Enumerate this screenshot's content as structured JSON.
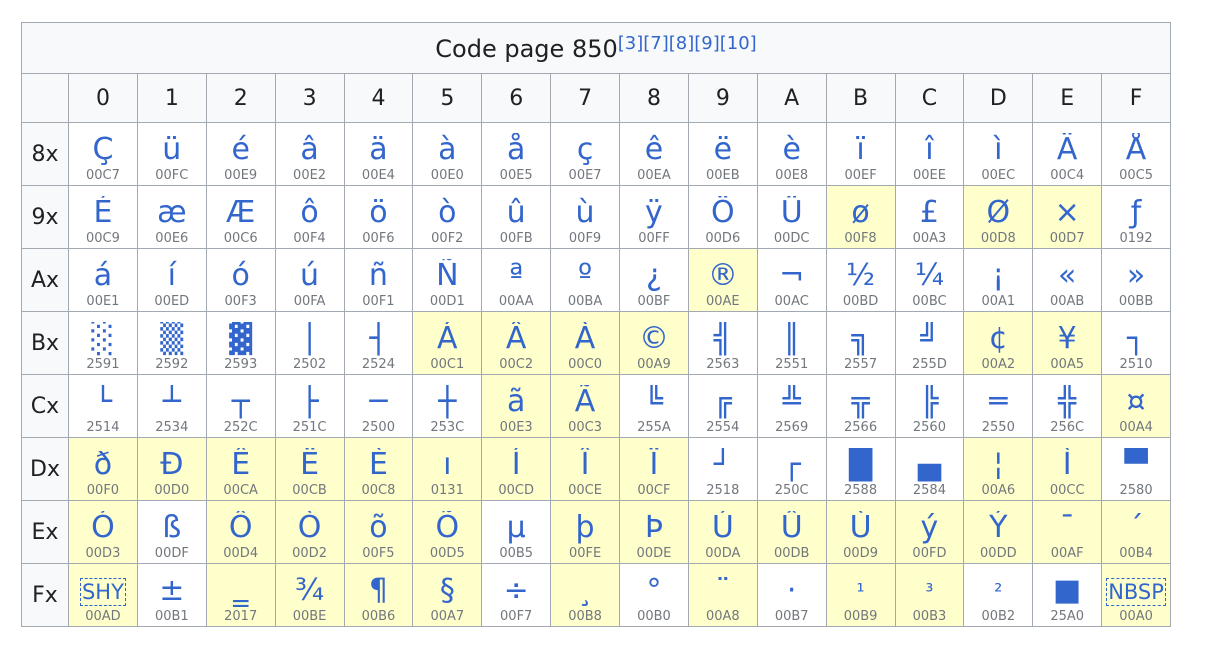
{
  "caption": {
    "title": "Code page 850",
    "refs": [
      "[3]",
      "[7]",
      "[8]",
      "[9]",
      "[10]"
    ]
  },
  "columns": [
    "0",
    "1",
    "2",
    "3",
    "4",
    "5",
    "6",
    "7",
    "8",
    "9",
    "A",
    "B",
    "C",
    "D",
    "E",
    "F"
  ],
  "rows": [
    {
      "label": "8x",
      "cells": [
        {
          "g": "Ç",
          "c": "00C7",
          "h": false
        },
        {
          "g": "ü",
          "c": "00FC",
          "h": false
        },
        {
          "g": "é",
          "c": "00E9",
          "h": false
        },
        {
          "g": "â",
          "c": "00E2",
          "h": false
        },
        {
          "g": "ä",
          "c": "00E4",
          "h": false
        },
        {
          "g": "à",
          "c": "00E0",
          "h": false
        },
        {
          "g": "å",
          "c": "00E5",
          "h": false
        },
        {
          "g": "ç",
          "c": "00E7",
          "h": false
        },
        {
          "g": "ê",
          "c": "00EA",
          "h": false
        },
        {
          "g": "ë",
          "c": "00EB",
          "h": false
        },
        {
          "g": "è",
          "c": "00E8",
          "h": false
        },
        {
          "g": "ï",
          "c": "00EF",
          "h": false
        },
        {
          "g": "î",
          "c": "00EE",
          "h": false
        },
        {
          "g": "ì",
          "c": "00EC",
          "h": false
        },
        {
          "g": "Ä",
          "c": "00C4",
          "h": false
        },
        {
          "g": "Å",
          "c": "00C5",
          "h": false
        }
      ]
    },
    {
      "label": "9x",
      "cells": [
        {
          "g": "É",
          "c": "00C9",
          "h": false
        },
        {
          "g": "æ",
          "c": "00E6",
          "h": false
        },
        {
          "g": "Æ",
          "c": "00C6",
          "h": false
        },
        {
          "g": "ô",
          "c": "00F4",
          "h": false
        },
        {
          "g": "ö",
          "c": "00F6",
          "h": false
        },
        {
          "g": "ò",
          "c": "00F2",
          "h": false
        },
        {
          "g": "û",
          "c": "00FB",
          "h": false
        },
        {
          "g": "ù",
          "c": "00F9",
          "h": false
        },
        {
          "g": "ÿ",
          "c": "00FF",
          "h": false
        },
        {
          "g": "Ö",
          "c": "00D6",
          "h": false
        },
        {
          "g": "Ü",
          "c": "00DC",
          "h": false
        },
        {
          "g": "ø",
          "c": "00F8",
          "h": true
        },
        {
          "g": "£",
          "c": "00A3",
          "h": false
        },
        {
          "g": "Ø",
          "c": "00D8",
          "h": true
        },
        {
          "g": "×",
          "c": "00D7",
          "h": true
        },
        {
          "g": "ƒ",
          "c": "0192",
          "h": false
        }
      ]
    },
    {
      "label": "Ax",
      "cells": [
        {
          "g": "á",
          "c": "00E1",
          "h": false
        },
        {
          "g": "í",
          "c": "00ED",
          "h": false
        },
        {
          "g": "ó",
          "c": "00F3",
          "h": false
        },
        {
          "g": "ú",
          "c": "00FA",
          "h": false
        },
        {
          "g": "ñ",
          "c": "00F1",
          "h": false
        },
        {
          "g": "Ñ",
          "c": "00D1",
          "h": false
        },
        {
          "g": "ª",
          "c": "00AA",
          "h": false
        },
        {
          "g": "º",
          "c": "00BA",
          "h": false
        },
        {
          "g": "¿",
          "c": "00BF",
          "h": false
        },
        {
          "g": "®",
          "c": "00AE",
          "h": true
        },
        {
          "g": "¬",
          "c": "00AC",
          "h": false
        },
        {
          "g": "½",
          "c": "00BD",
          "h": false
        },
        {
          "g": "¼",
          "c": "00BC",
          "h": false
        },
        {
          "g": "¡",
          "c": "00A1",
          "h": false
        },
        {
          "g": "«",
          "c": "00AB",
          "h": false
        },
        {
          "g": "»",
          "c": "00BB",
          "h": false
        }
      ]
    },
    {
      "label": "Bx",
      "cells": [
        {
          "g": "░",
          "c": "2591",
          "h": false
        },
        {
          "g": "▒",
          "c": "2592",
          "h": false
        },
        {
          "g": "▓",
          "c": "2593",
          "h": false
        },
        {
          "g": "│",
          "c": "2502",
          "h": false
        },
        {
          "g": "┤",
          "c": "2524",
          "h": false
        },
        {
          "g": "Á",
          "c": "00C1",
          "h": true
        },
        {
          "g": "Â",
          "c": "00C2",
          "h": true
        },
        {
          "g": "À",
          "c": "00C0",
          "h": true
        },
        {
          "g": "©",
          "c": "00A9",
          "h": true
        },
        {
          "g": "╣",
          "c": "2563",
          "h": false
        },
        {
          "g": "║",
          "c": "2551",
          "h": false
        },
        {
          "g": "╗",
          "c": "2557",
          "h": false
        },
        {
          "g": "╝",
          "c": "255D",
          "h": false
        },
        {
          "g": "¢",
          "c": "00A2",
          "h": true
        },
        {
          "g": "¥",
          "c": "00A5",
          "h": true
        },
        {
          "g": "┐",
          "c": "2510",
          "h": false
        }
      ]
    },
    {
      "label": "Cx",
      "cells": [
        {
          "g": "└",
          "c": "2514",
          "h": false
        },
        {
          "g": "┴",
          "c": "2534",
          "h": false
        },
        {
          "g": "┬",
          "c": "252C",
          "h": false
        },
        {
          "g": "├",
          "c": "251C",
          "h": false
        },
        {
          "g": "─",
          "c": "2500",
          "h": false
        },
        {
          "g": "┼",
          "c": "253C",
          "h": false
        },
        {
          "g": "ã",
          "c": "00E3",
          "h": true
        },
        {
          "g": "Ã",
          "c": "00C3",
          "h": true
        },
        {
          "g": "╚",
          "c": "255A",
          "h": false
        },
        {
          "g": "╔",
          "c": "2554",
          "h": false
        },
        {
          "g": "╩",
          "c": "2569",
          "h": false
        },
        {
          "g": "╦",
          "c": "2566",
          "h": false
        },
        {
          "g": "╠",
          "c": "2560",
          "h": false
        },
        {
          "g": "═",
          "c": "2550",
          "h": false
        },
        {
          "g": "╬",
          "c": "256C",
          "h": false
        },
        {
          "g": "¤",
          "c": "00A4",
          "h": true
        }
      ]
    },
    {
      "label": "Dx",
      "cells": [
        {
          "g": "ð",
          "c": "00F0",
          "h": true
        },
        {
          "g": "Ð",
          "c": "00D0",
          "h": true
        },
        {
          "g": "Ê",
          "c": "00CA",
          "h": true
        },
        {
          "g": "Ë",
          "c": "00CB",
          "h": true
        },
        {
          "g": "È",
          "c": "00C8",
          "h": true
        },
        {
          "g": "ı",
          "c": "0131",
          "h": true
        },
        {
          "g": "Í",
          "c": "00CD",
          "h": true
        },
        {
          "g": "Î",
          "c": "00CE",
          "h": true
        },
        {
          "g": "Ï",
          "c": "00CF",
          "h": true
        },
        {
          "g": "┘",
          "c": "2518",
          "h": false
        },
        {
          "g": "┌",
          "c": "250C",
          "h": false
        },
        {
          "g": "█",
          "c": "2588",
          "h": false
        },
        {
          "g": "▄",
          "c": "2584",
          "h": false
        },
        {
          "g": "¦",
          "c": "00A6",
          "h": true
        },
        {
          "g": "Ì",
          "c": "00CC",
          "h": true
        },
        {
          "g": "▀",
          "c": "2580",
          "h": false
        }
      ]
    },
    {
      "label": "Ex",
      "cells": [
        {
          "g": "Ó",
          "c": "00D3",
          "h": true
        },
        {
          "g": "ß",
          "c": "00DF",
          "h": false
        },
        {
          "g": "Ô",
          "c": "00D4",
          "h": true
        },
        {
          "g": "Ò",
          "c": "00D2",
          "h": true
        },
        {
          "g": "õ",
          "c": "00F5",
          "h": true
        },
        {
          "g": "Õ",
          "c": "00D5",
          "h": true
        },
        {
          "g": "µ",
          "c": "00B5",
          "h": false
        },
        {
          "g": "þ",
          "c": "00FE",
          "h": true
        },
        {
          "g": "Þ",
          "c": "00DE",
          "h": true
        },
        {
          "g": "Ú",
          "c": "00DA",
          "h": true
        },
        {
          "g": "Û",
          "c": "00DB",
          "h": true
        },
        {
          "g": "Ù",
          "c": "00D9",
          "h": true
        },
        {
          "g": "ý",
          "c": "00FD",
          "h": true
        },
        {
          "g": "Ý",
          "c": "00DD",
          "h": true
        },
        {
          "g": "¯",
          "c": "00AF",
          "h": true
        },
        {
          "g": "´",
          "c": "00B4",
          "h": true
        }
      ]
    },
    {
      "label": "Fx",
      "cells": [
        {
          "g": "SHY",
          "c": "00AD",
          "h": true,
          "tag": true
        },
        {
          "g": "±",
          "c": "00B1",
          "h": false
        },
        {
          "g": "‗",
          "c": "2017",
          "h": true
        },
        {
          "g": "¾",
          "c": "00BE",
          "h": true
        },
        {
          "g": "¶",
          "c": "00B6",
          "h": true
        },
        {
          "g": "§",
          "c": "00A7",
          "h": true
        },
        {
          "g": "÷",
          "c": "00F7",
          "h": false
        },
        {
          "g": "¸",
          "c": "00B8",
          "h": true
        },
        {
          "g": "°",
          "c": "00B0",
          "h": false
        },
        {
          "g": "¨",
          "c": "00A8",
          "h": true
        },
        {
          "g": "·",
          "c": "00B7",
          "h": false
        },
        {
          "g": "¹",
          "c": "00B9",
          "h": true,
          "small": true
        },
        {
          "g": "³",
          "c": "00B3",
          "h": true,
          "small": true
        },
        {
          "g": "²",
          "c": "00B2",
          "h": false,
          "small": true
        },
        {
          "g": "■",
          "c": "25A0",
          "h": false
        },
        {
          "g": "NBSP",
          "c": "00A0",
          "h": true,
          "tag": true
        }
      ]
    }
  ]
}
